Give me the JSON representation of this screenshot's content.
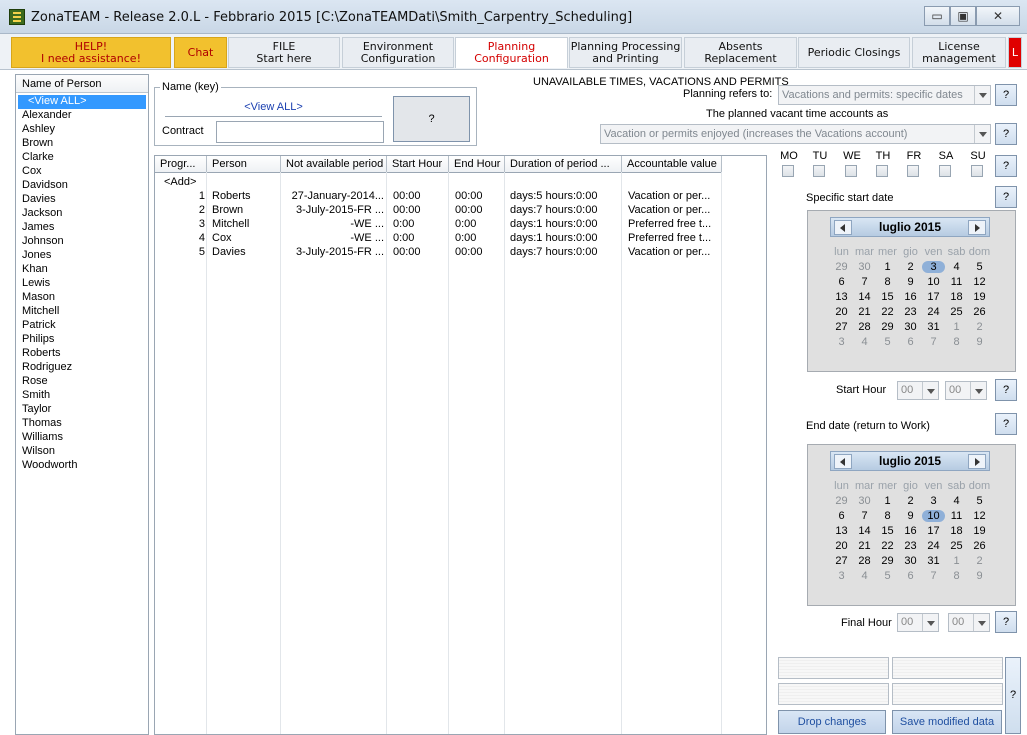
{
  "window": {
    "title": "ZonaTEAM - Release 2.0.L - Febbrario 2015 [C:\\ZonaTEAMDati\\Smith_Carpentry_Scheduling]",
    "minimize": "▭",
    "maximize": "▣",
    "close": "✕"
  },
  "tabs": [
    {
      "label": "HELP!\nI need assistance!"
    },
    {
      "label": "Chat"
    },
    {
      "label": "FILE\nStart here"
    },
    {
      "label": "Environment\nConfiguration"
    },
    {
      "label": "Planning Configuration"
    },
    {
      "label": "Planning Processing\nand Printing"
    },
    {
      "label": "Absents Replacement"
    },
    {
      "label": "Periodic Closings"
    },
    {
      "label": "License\nmanagement"
    },
    {
      "label": "L"
    }
  ],
  "person_list": {
    "header": "Name of Person",
    "items": [
      "<View ALL>",
      "Alexander",
      "Ashley",
      "Brown",
      "Clarke",
      "Cox",
      "Davidson",
      "Davies",
      "Jackson",
      "James",
      "Johnson",
      "Jones",
      "Khan",
      "Lewis",
      "Mason",
      "Mitchell",
      "Patrick",
      "Philips",
      "Roberts",
      "Rodriguez",
      "Rose",
      "Smith",
      "Taylor",
      "Thomas",
      "Williams",
      "Wilson",
      "Woodworth"
    ]
  },
  "name_group": {
    "legend": "Name (key)",
    "value": "<View ALL>",
    "contract_label": "Contract",
    "button": "?"
  },
  "unavailable": {
    "title": "UNAVAILABLE TIMES, VACATIONS AND PERMITS",
    "refers_label": "Planning refers to:",
    "refers_value": "Vacations and permits: specific dates",
    "accounts_label": "The planned vacant time accounts as",
    "accounts_value": "Vacation or permits enjoyed (increases the Vacations account)"
  },
  "grid": {
    "columns": [
      "Progr...",
      "Person",
      "Not available period",
      "Start Hour",
      "End Hour",
      "Duration of period ...",
      "Accountable value"
    ],
    "add_label": "<Add>",
    "rows": [
      {
        "n": "1",
        "person": "Roberts",
        "period": "27-January-2014...",
        "start": "00:00",
        "end": "00:00",
        "duration": "days:5 hours:0:00",
        "value": "Vacation or per..."
      },
      {
        "n": "2",
        "person": "Brown",
        "period": "3-July-2015-FR ...",
        "start": "00:00",
        "end": "00:00",
        "duration": "days:7 hours:0:00",
        "value": "Vacation or per..."
      },
      {
        "n": "3",
        "person": "Mitchell",
        "period": "-WE ...",
        "start": "0:00",
        "end": "0:00",
        "duration": "days:1 hours:0:00",
        "value": "Preferred free t..."
      },
      {
        "n": "4",
        "person": "Cox",
        "period": "-WE ...",
        "start": "0:00",
        "end": "0:00",
        "duration": "days:1 hours:0:00",
        "value": "Preferred free t..."
      },
      {
        "n": "5",
        "person": "Davies",
        "period": "3-July-2015-FR ...",
        "start": "00:00",
        "end": "00:00",
        "duration": "days:7 hours:0:00",
        "value": "Vacation or per..."
      }
    ]
  },
  "weekdays": [
    "MO",
    "TU",
    "WE",
    "TH",
    "FR",
    "SA",
    "SU"
  ],
  "help_button": "?",
  "start_date": {
    "label": "Specific start date",
    "month": "luglio 2015",
    "dow": [
      "lun",
      "mar",
      "mer",
      "gio",
      "ven",
      "sab",
      "dom"
    ],
    "days": [
      "29",
      "30",
      "1",
      "2",
      "3",
      "4",
      "5",
      "6",
      "7",
      "8",
      "9",
      "10",
      "11",
      "12",
      "13",
      "14",
      "15",
      "16",
      "17",
      "18",
      "19",
      "20",
      "21",
      "22",
      "23",
      "24",
      "25",
      "26",
      "27",
      "28",
      "29",
      "30",
      "31",
      "1",
      "2",
      "3",
      "4",
      "5",
      "6",
      "7",
      "8",
      "9"
    ],
    "today": "3"
  },
  "start_hour": {
    "label": "Start Hour",
    "hh": "00",
    "mm": "00"
  },
  "end_date": {
    "label": "End date (return to Work)",
    "month": "luglio 2015",
    "dow": [
      "lun",
      "mar",
      "mer",
      "gio",
      "ven",
      "sab",
      "dom"
    ],
    "days": [
      "29",
      "30",
      "1",
      "2",
      "3",
      "4",
      "5",
      "6",
      "7",
      "8",
      "9",
      "10",
      "11",
      "12",
      "13",
      "14",
      "15",
      "16",
      "17",
      "18",
      "19",
      "20",
      "21",
      "22",
      "23",
      "24",
      "25",
      "26",
      "27",
      "28",
      "29",
      "30",
      "31",
      "1",
      "2",
      "3",
      "4",
      "5",
      "6",
      "7",
      "8",
      "9"
    ],
    "today": "10"
  },
  "final_hour": {
    "label": "Final Hour",
    "hh": "00",
    "mm": "00"
  },
  "actions": {
    "drop": "Drop changes",
    "save": "Save modified data"
  }
}
